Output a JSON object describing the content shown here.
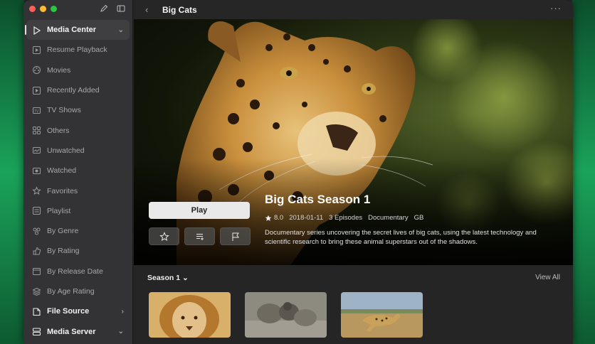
{
  "window": {
    "title": "Big Cats"
  },
  "sidebar": {
    "items": [
      {
        "label": "Media Center",
        "icon": "media-center-icon",
        "type": "section",
        "active": true,
        "chevron": "⌄"
      },
      {
        "label": "Resume Playback",
        "icon": "resume-playback-icon"
      },
      {
        "label": "Movies",
        "icon": "movies-icon"
      },
      {
        "label": "Recently Added",
        "icon": "recently-added-icon"
      },
      {
        "label": "TV Shows",
        "icon": "tv-shows-icon"
      },
      {
        "label": "Others",
        "icon": "others-icon"
      },
      {
        "label": "Unwatched",
        "icon": "unwatched-icon"
      },
      {
        "label": "Watched",
        "icon": "watched-icon"
      },
      {
        "label": "Favorites",
        "icon": "favorites-icon"
      },
      {
        "label": "Playlist",
        "icon": "playlist-icon"
      },
      {
        "label": "By Genre",
        "icon": "genre-icon"
      },
      {
        "label": "By Rating",
        "icon": "rating-icon"
      },
      {
        "label": "By Release Date",
        "icon": "release-date-icon"
      },
      {
        "label": "By Age Rating",
        "icon": "age-rating-icon"
      },
      {
        "label": "File Source",
        "icon": "file-source-icon",
        "type": "section",
        "chevron": "›"
      },
      {
        "label": "Media Server",
        "icon": "media-server-icon",
        "type": "section",
        "chevron": "⌄"
      }
    ]
  },
  "hero": {
    "play_label": "Play",
    "title": "Big Cats Season 1",
    "rating": "8.0",
    "date": "2018-01-11",
    "episodes": "3 Episodes",
    "genre": "Documentary",
    "country": "GB",
    "description": "Documentary series uncovering the secret lives of big cats, using the latest technology and scientific research to bring these animal superstars out of the shadows."
  },
  "season": {
    "label": "Season 1",
    "view_all": "View All"
  },
  "colors": {
    "accent_bg": "#1aa35a",
    "sidebar_bg": "#333335",
    "main_bg": "#1f1f1f"
  }
}
